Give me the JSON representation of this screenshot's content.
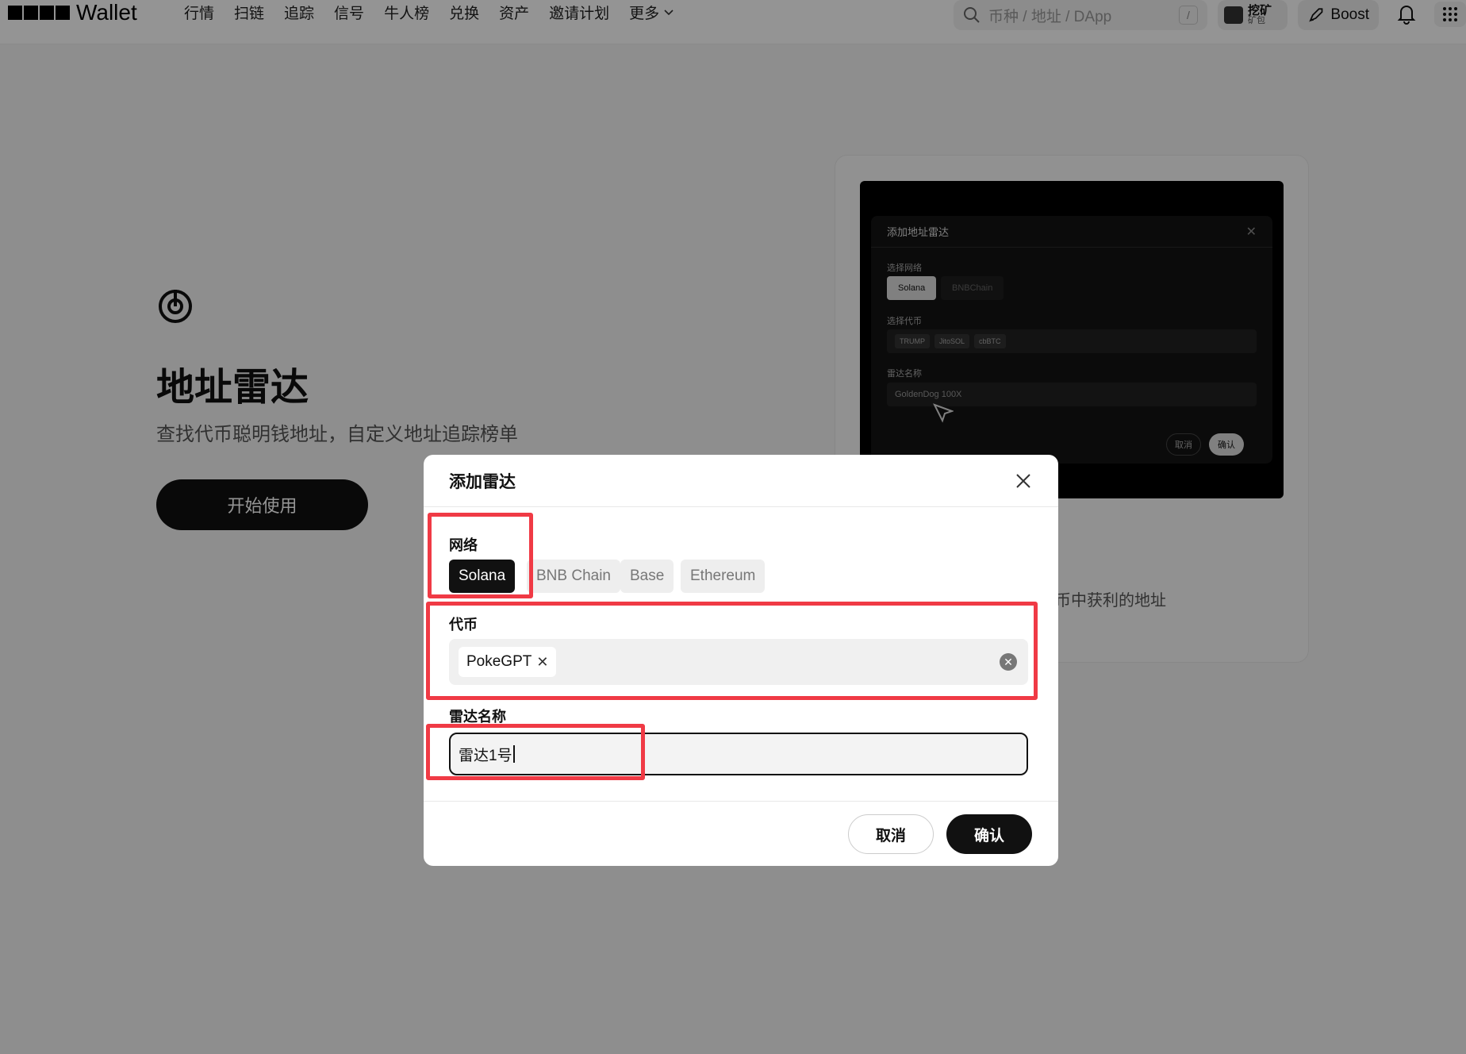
{
  "header": {
    "logo_text": "Wallet",
    "nav": [
      "行情",
      "扫链",
      "追踪",
      "信号",
      "牛人榜",
      "兑换",
      "资产",
      "邀请计划"
    ],
    "more_label": "更多",
    "search_placeholder": "币种 / 地址 / DApp",
    "search_shortcut": "/",
    "mine_label": "挖矿",
    "mine_sub": "矿包",
    "boost_label": "Boost"
  },
  "hero": {
    "title": "地址雷达",
    "subtitle": "查找代币聪明钱地址，自定义地址追踪榜单",
    "start_button": "开始使用"
  },
  "demo": {
    "dialog_title": "添加地址雷达",
    "network_label": "选择网络",
    "networks": [
      "Solana",
      "BNBChain"
    ],
    "token_label": "选择代币",
    "tokens": [
      "TRUMP",
      "JitoSOL",
      "cbBTC"
    ],
    "name_label": "雷达名称",
    "name_value": "GoldenDog 100X",
    "cancel": "取消",
    "confirm": "确认",
    "caption": "币中获利的地址"
  },
  "modal": {
    "title": "添加雷达",
    "network_label": "网络",
    "networks": [
      "Solana",
      "BNB Chain",
      "Base",
      "Ethereum"
    ],
    "selected_network": "Solana",
    "token_label": "代币",
    "token_tag": "PokeGPT",
    "name_label": "雷达名称",
    "name_value": "雷达1号",
    "cancel": "取消",
    "confirm": "确认"
  },
  "colors": {
    "highlight": "#f03a45",
    "primary": "#111111",
    "overlay": "rgba(0,0,0,0.42)"
  }
}
